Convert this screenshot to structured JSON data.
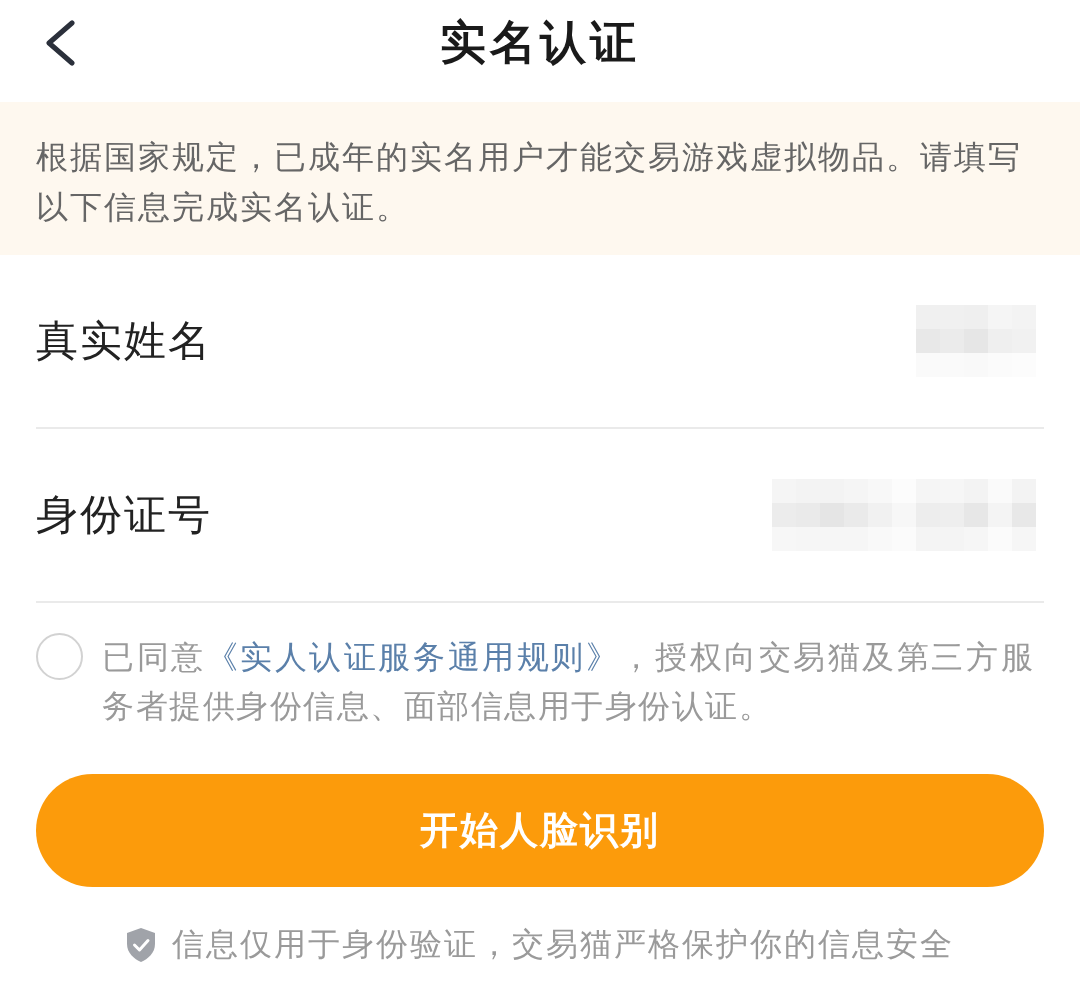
{
  "header": {
    "title": "实名认证"
  },
  "notice": {
    "text": "根据国家规定，已成年的实名用户才能交易游戏虚拟物品。请填写以下信息完成实名认证。"
  },
  "fields": [
    {
      "label": "真实姓名",
      "value_redacted": true
    },
    {
      "label": "身份证号",
      "value_redacted": true
    }
  ],
  "agreement": {
    "checked": false,
    "text_before": "已同意",
    "link": "《实人认证服务通用规则》",
    "text_after": "，授权向交易猫及第三方服务者提供身份信息、面部信息用于身份认证。"
  },
  "primary_button": {
    "label": "开始人脸识别"
  },
  "footer": {
    "text": "信息仅用于身份验证，交易猫严格保护你的信息安全"
  }
}
